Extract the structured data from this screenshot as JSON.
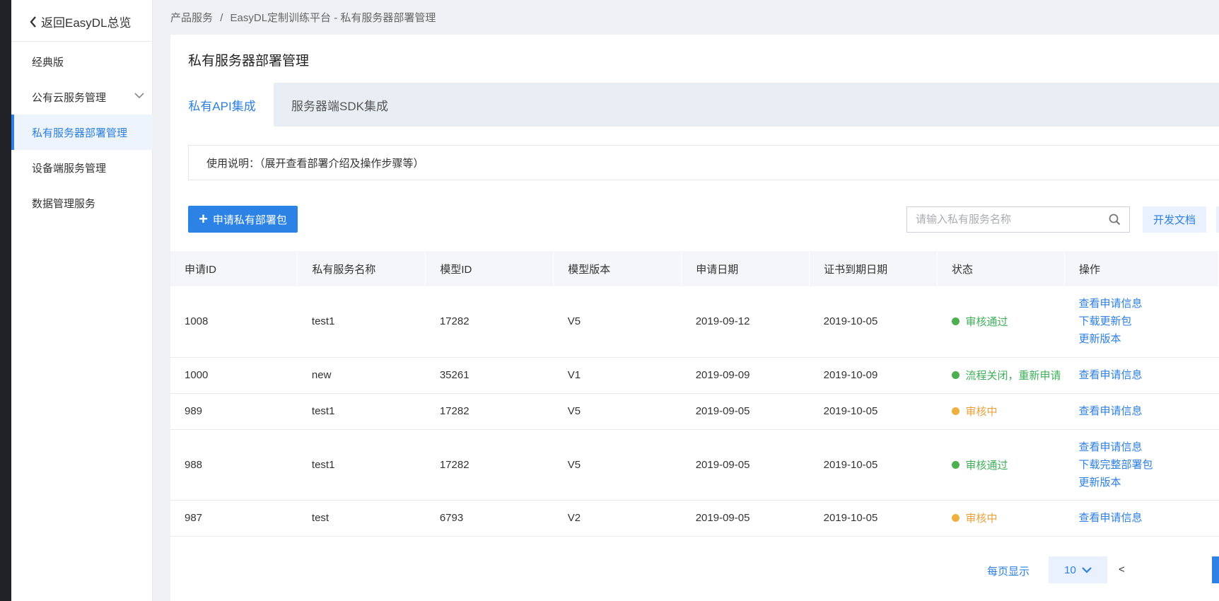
{
  "sidebar": {
    "back_label": "返回EasyDL总览",
    "items": [
      {
        "label": "经典版"
      },
      {
        "label": "公有云服务管理"
      },
      {
        "label": "私有服务器部署管理"
      },
      {
        "label": "设备端服务管理"
      },
      {
        "label": "数据管理服务"
      }
    ]
  },
  "breadcrumb": {
    "root": "产品服务",
    "sep": "/",
    "current": "EasyDL定制训练平台 - 私有服务器部署管理"
  },
  "page": {
    "title": "私有服务器部署管理",
    "tabs": [
      {
        "label": "私有API集成"
      },
      {
        "label": "服务器端SDK集成"
      }
    ],
    "notice": "使用说明：（展开查看部署介绍及操作步骤等）",
    "apply_button": "申请私有部署包",
    "search_placeholder": "请输入私有服务名称",
    "doc_button": "开发文档"
  },
  "table": {
    "headers": [
      "申请ID",
      "私有服务名称",
      "模型ID",
      "模型版本",
      "申请日期",
      "证书到期日期",
      "状态",
      "操作"
    ],
    "rows": [
      {
        "id": "1008",
        "name": "test1",
        "model_id": "17282",
        "version": "V5",
        "apply_date": "2019-09-12",
        "expire_date": "2019-10-05",
        "status": "审核通过",
        "ops": [
          "查看申请信息",
          "下载更新包",
          "更新版本"
        ]
      },
      {
        "id": "1000",
        "name": "new",
        "model_id": "35261",
        "version": "V1",
        "apply_date": "2019-09-09",
        "expire_date": "2019-10-09",
        "status": "流程关闭，重新申请",
        "ops": [
          "查看申请信息"
        ]
      },
      {
        "id": "989",
        "name": "test1",
        "model_id": "17282",
        "version": "V5",
        "apply_date": "2019-09-05",
        "expire_date": "2019-10-05",
        "status": "审核中",
        "ops": [
          "查看申请信息"
        ]
      },
      {
        "id": "988",
        "name": "test1",
        "model_id": "17282",
        "version": "V5",
        "apply_date": "2019-09-05",
        "expire_date": "2019-10-05",
        "status": "审核通过",
        "ops": [
          "查看申请信息",
          "下载完整部署包",
          "更新版本"
        ]
      },
      {
        "id": "987",
        "name": "test",
        "model_id": "6793",
        "version": "V2",
        "apply_date": "2019-09-05",
        "expire_date": "2019-10-05",
        "status": "审核中",
        "ops": [
          "查看申请信息"
        ]
      }
    ]
  },
  "pagination": {
    "per_page_label": "每页显示",
    "page_size": "10",
    "prev": "<"
  },
  "colors": {
    "accent": "#2d7fe0",
    "success": "#4caf50",
    "warning": "#f0b03d"
  }
}
